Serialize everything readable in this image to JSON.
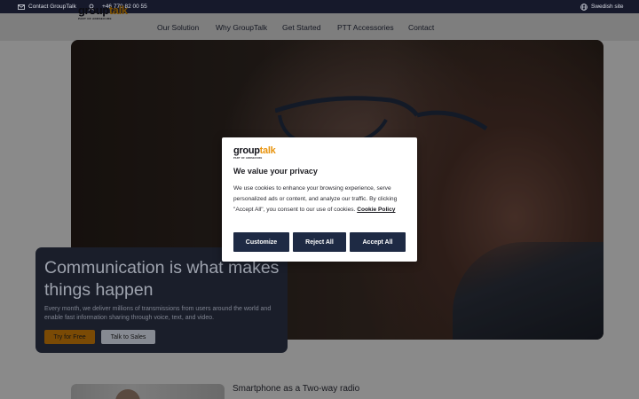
{
  "topbar": {
    "contact_label": "Contact GroupTalk",
    "phone": "+46 770 82 00 55",
    "site_label": "Swedish site"
  },
  "brand": {
    "word_part1": "group",
    "word_part2": "talk",
    "tagline": "PART OF ADDSECURE"
  },
  "nav": {
    "items": [
      {
        "label": "Our Solution"
      },
      {
        "label": "Why GroupTalk"
      },
      {
        "label": "Get Started"
      },
      {
        "label": "PTT Accessories"
      },
      {
        "label": "Contact"
      }
    ]
  },
  "hero": {
    "title": "Communication is what makes things happen",
    "subtitle": "Every month, we deliver millions of transmissions from users around the world and enable fast information sharing through voice, text, and video.",
    "primary_button": "Try for Free",
    "secondary_button": "Talk to Sales"
  },
  "section2": {
    "title": "Smartphone as a Two-way radio"
  },
  "consent": {
    "title": "We value your privacy",
    "body": "We use cookies to enhance your browsing experience, serve personalized ads or content, and analyze our traffic. By clicking \"Accept All\", you consent to our use of cookies.",
    "policy_link": "Cookie Policy",
    "customize_button": "Customize",
    "reject_button": "Reject All",
    "accept_button": "Accept All"
  },
  "colors": {
    "topbar_bg": "#16192b",
    "brand_orange": "#e8940f",
    "consent_button": "#1e2a44",
    "hero_card_bg": "#1a1e2a"
  },
  "icons": {
    "contact": "mail-icon",
    "phone": "headset-icon",
    "site": "globe-icon"
  }
}
